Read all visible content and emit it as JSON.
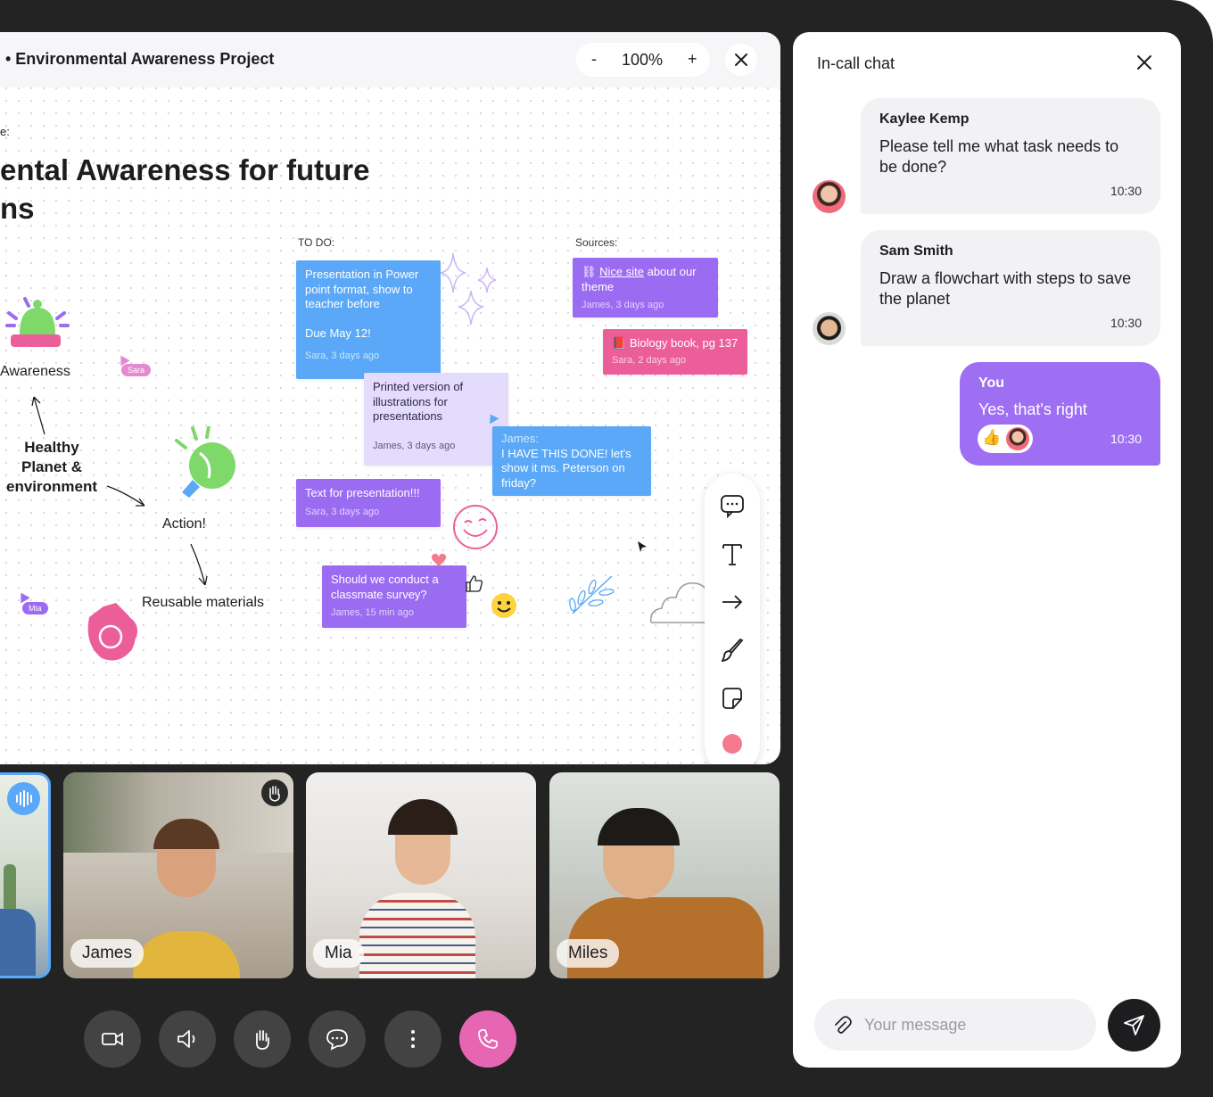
{
  "board": {
    "project_title": "• Environmental Awareness Project",
    "zoom": {
      "minus": "-",
      "value": "100%",
      "plus": "+"
    },
    "close_icon": "close-icon",
    "topic_label": "e:",
    "heading_line1": "ental Awareness for future",
    "heading_line2": "ns",
    "todo_label": "TO DO:",
    "sources_label": "Sources:",
    "notes": {
      "presentation": {
        "text": "Presentation in Power point format, show to teacher before\n\nDue May 12!",
        "meta": "Sara, 3 days ago"
      },
      "printed": {
        "text": "Printed version of illustrations for presentations",
        "meta": "James, 3 days ago"
      },
      "text_for_presentation": {
        "text": "Text for presentation!!!",
        "meta": "Sara, 3 days ago"
      },
      "survey": {
        "text": "Should we conduct a classmate survey?",
        "meta": "James, 15 min ago"
      },
      "james_done": {
        "author": "James:",
        "text": "I HAVE THIS DONE! let's show it ms. Peterson on friday?"
      },
      "nice_site": {
        "link": "Nice site",
        "text": " about our theme",
        "meta": "James, 3 days ago"
      },
      "biology": {
        "text": "Biology book, pg 137",
        "meta": "Sara, 2 days ago"
      }
    },
    "cursor_tags": {
      "sara": "Sara",
      "mia": "Mia"
    },
    "mindmap": {
      "awareness": "Awareness",
      "healthy": "Healthy\nPlanet &\nenvironment",
      "action": "Action!",
      "reusable": "Reusable materials"
    },
    "toolbar": [
      "comment-icon",
      "text-icon",
      "arrow-icon",
      "brush-icon",
      "sticky-note-icon",
      "color-swatch"
    ],
    "colors": {
      "blue": "#5aa8f7",
      "violet": "#9b6bf2",
      "pink": "#ec5e9a",
      "lilac": "#e4dcfd",
      "swatch": "#f47a8e"
    }
  },
  "participants": [
    {
      "name": ""
    },
    {
      "name": "James"
    },
    {
      "name": "Mia"
    },
    {
      "name": "Miles"
    }
  ],
  "controls": [
    "camera-icon",
    "speaker-icon",
    "raise-hand-icon",
    "chat-icon",
    "more-icon",
    "end-call-icon"
  ],
  "chat": {
    "title": "In-call chat",
    "messages": [
      {
        "name": "Kaylee Kemp",
        "text": "Please tell me what task needs to be done?",
        "time": "10:30"
      },
      {
        "name": "Sam Smith",
        "text": "Draw a flowchart with steps to save the planet",
        "time": "10:30"
      },
      {
        "name": "You",
        "text": "Yes, that's right",
        "time": "10:30"
      }
    ],
    "input_placeholder": "Your message",
    "accent": "#9f6ff3"
  }
}
